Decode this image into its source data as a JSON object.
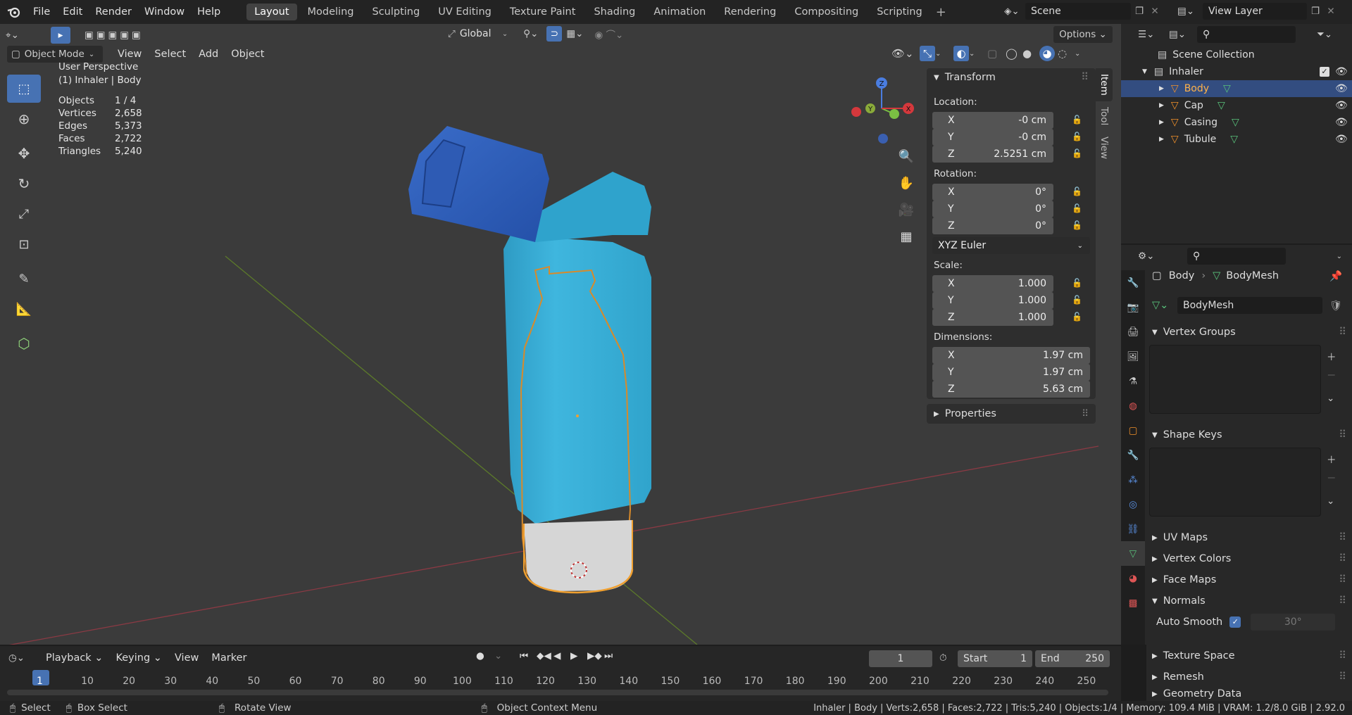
{
  "menus": [
    "File",
    "Edit",
    "Render",
    "Window",
    "Help"
  ],
  "workspaces": [
    "Layout",
    "Modeling",
    "Sculpting",
    "UV Editing",
    "Texture Paint",
    "Shading",
    "Animation",
    "Rendering",
    "Compositing",
    "Scripting"
  ],
  "scene_name": "Scene",
  "view_layer": "View Layer",
  "toolbar": {
    "orientation": "Global",
    "options": "Options"
  },
  "viewport_header": {
    "mode": "Object Mode",
    "view": "View",
    "select": "Select",
    "add": "Add",
    "object": "Object"
  },
  "overlay_text": {
    "perspective": "User Perspective",
    "context": "(1) Inhaler | Body",
    "stats": [
      {
        "label": "Objects",
        "value": "1 / 4"
      },
      {
        "label": "Vertices",
        "value": "2,658"
      },
      {
        "label": "Edges",
        "value": "5,373"
      },
      {
        "label": "Faces",
        "value": "2,722"
      },
      {
        "label": "Triangles",
        "value": "5,240"
      }
    ]
  },
  "gizmo": {
    "z": "Z",
    "y": "Y",
    "x": "X"
  },
  "npanel": {
    "header": "Transform",
    "location_label": "Location:",
    "location": [
      {
        "axis": "X",
        "value": "-0 cm"
      },
      {
        "axis": "Y",
        "value": "-0 cm"
      },
      {
        "axis": "Z",
        "value": "2.5251 cm"
      }
    ],
    "rotation_label": "Rotation:",
    "rotation": [
      {
        "axis": "X",
        "value": "0°"
      },
      {
        "axis": "Y",
        "value": "0°"
      },
      {
        "axis": "Z",
        "value": "0°"
      }
    ],
    "rotation_mode": "XYZ Euler",
    "scale_label": "Scale:",
    "scale": [
      {
        "axis": "X",
        "value": "1.000"
      },
      {
        "axis": "Y",
        "value": "1.000"
      },
      {
        "axis": "Z",
        "value": "1.000"
      }
    ],
    "dimensions_label": "Dimensions:",
    "dimensions": [
      {
        "axis": "X",
        "value": "1.97 cm"
      },
      {
        "axis": "Y",
        "value": "1.97 cm"
      },
      {
        "axis": "Z",
        "value": "5.63 cm"
      }
    ],
    "properties": "Properties",
    "tabs": [
      "Item",
      "Tool",
      "View"
    ]
  },
  "outliner": {
    "root": "Scene Collection",
    "collection": "Inhaler",
    "items": [
      "Body",
      "Cap",
      "Casing",
      "Tubule"
    ]
  },
  "properties_panel": {
    "object": "Body",
    "mesh": "BodyMesh",
    "mesh_field": "BodyMesh",
    "sections": [
      "Vertex Groups",
      "Shape Keys",
      "UV Maps",
      "Vertex Colors",
      "Face Maps",
      "Normals",
      "Texture Space",
      "Remesh",
      "Geometry Data"
    ],
    "auto_smooth": "Auto Smooth",
    "auto_smooth_angle": "30°"
  },
  "timeline": {
    "playback": "Playback",
    "keying": "Keying",
    "view": "View",
    "marker": "Marker",
    "current_frame": "1",
    "start_label": "Start",
    "start": "1",
    "end_label": "End",
    "end": "250",
    "ticks": [
      "1",
      "10",
      "20",
      "30",
      "40",
      "50",
      "60",
      "70",
      "80",
      "90",
      "100",
      "110",
      "120",
      "130",
      "140",
      "150",
      "160",
      "170",
      "180",
      "190",
      "200",
      "210",
      "220",
      "230",
      "240",
      "250"
    ]
  },
  "statusbar": {
    "select": "Select",
    "box_select": "Box Select",
    "rotate_view": "Rotate View",
    "context_menu": "Object Context Menu",
    "info": "Inhaler | Body | Verts:2,658 | Faces:2,722 | Tris:5,240 | Objects:1/4 | Memory: 109.4 MiB | VRAM: 1.2/8.0 GiB | 2.92.0"
  }
}
